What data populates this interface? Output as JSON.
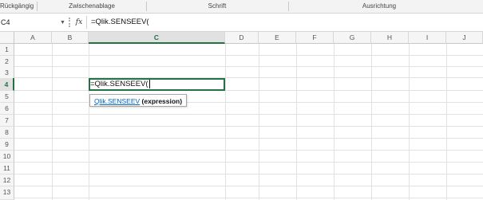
{
  "ribbon": {
    "groups": [
      {
        "label": "Rückgängig"
      },
      {
        "label": "Zwischenablage"
      },
      {
        "label": "Schrift"
      },
      {
        "label": "Ausrichtung"
      }
    ]
  },
  "formula_bar": {
    "name_box": "C4",
    "fx_label": "fx",
    "formula": "=Qlik.SENSEEV("
  },
  "grid": {
    "columns": [
      "A",
      "B",
      "C",
      "D",
      "E",
      "F",
      "G",
      "H",
      "I",
      "J"
    ],
    "active_column": "C",
    "rows": [
      "1",
      "2",
      "3",
      "4",
      "5",
      "6",
      "7",
      "8",
      "9",
      "10",
      "11",
      "12",
      "13"
    ],
    "active_row": "4",
    "active_cell_text": "=Qlik.SENSEEV("
  },
  "tooltip": {
    "function_name": "Qlik.SENSEEV",
    "argument": "(expression)"
  },
  "colors": {
    "accent": "#217346",
    "link": "#0563c1"
  }
}
